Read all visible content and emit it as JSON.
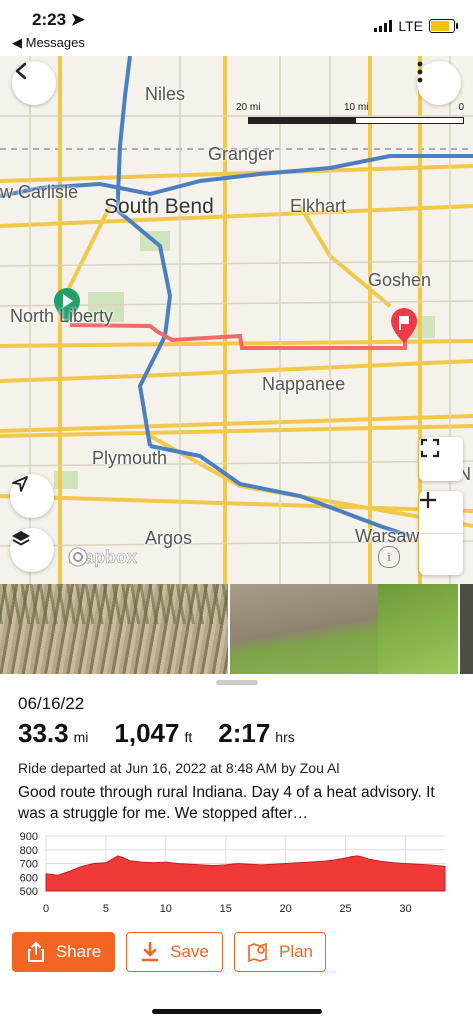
{
  "status_bar": {
    "time": "2:23",
    "back_app": "◀ Messages",
    "network": "LTE",
    "battery_level": 0.8
  },
  "map": {
    "scale": {
      "left_label": "20 mi",
      "mid_label": "10 mi",
      "right_label": "0"
    },
    "cities": [
      {
        "name": "Niles",
        "size": "small"
      },
      {
        "name": "Granger",
        "size": "small"
      },
      {
        "name": "w Carlisle",
        "size": "small"
      },
      {
        "name": "South Bend",
        "size": "big"
      },
      {
        "name": "Elkhart",
        "size": "small"
      },
      {
        "name": "Goshen",
        "size": "small"
      },
      {
        "name": "North Liberty",
        "size": "small"
      },
      {
        "name": "Nappanee",
        "size": "small"
      },
      {
        "name": "Plymouth",
        "size": "small"
      },
      {
        "name": "N",
        "size": "small"
      },
      {
        "name": "Argos",
        "size": "small"
      },
      {
        "name": "Warsaw",
        "size": "small"
      }
    ],
    "attribution": "mapbox",
    "info": "i",
    "route_color": "#f26a6a"
  },
  "ride": {
    "date": "06/16/22",
    "distance": {
      "value": "33.3",
      "unit": "mi"
    },
    "elevation": {
      "value": "1,047",
      "unit": "ft"
    },
    "duration": {
      "value": "2:17",
      "unit": "hrs"
    },
    "meta": "Ride departed at Jun 16, 2022 at 8:48 AM by Zou Al",
    "description": "Good route through rural Indiana.  Day 4 of a heat advisory.  It was a struggle for me.  We stopped after…"
  },
  "actions": {
    "share": "Share",
    "save": "Save",
    "plan": "Plan"
  },
  "colors": {
    "accent": "#f26522",
    "elevation_fill": "#f03a3a"
  },
  "chart_data": {
    "type": "area",
    "title": "",
    "xlabel": "",
    "ylabel": "",
    "xlim": [
      0,
      33.3
    ],
    "ylim": [
      500,
      900
    ],
    "x_ticks": [
      0,
      5,
      10,
      15,
      20,
      25,
      30
    ],
    "y_ticks": [
      900,
      800,
      700,
      600,
      500
    ],
    "grid": true,
    "series": [
      {
        "x": [
          0,
          1,
          2,
          3,
          4,
          5,
          5.5,
          6,
          6.5,
          7,
          8,
          9,
          10,
          11,
          12,
          13,
          14,
          15,
          16,
          17,
          18,
          19,
          20,
          21,
          22,
          23,
          24,
          25,
          25.5,
          26,
          26.5,
          27,
          28,
          29,
          30,
          31,
          32,
          33.3
        ],
        "y": [
          625,
          615,
          645,
          680,
          700,
          705,
          730,
          755,
          740,
          720,
          710,
          705,
          710,
          700,
          695,
          690,
          685,
          690,
          700,
          695,
          690,
          695,
          700,
          705,
          710,
          715,
          725,
          740,
          750,
          755,
          745,
          730,
          715,
          705,
          700,
          695,
          690,
          680
        ]
      }
    ]
  }
}
